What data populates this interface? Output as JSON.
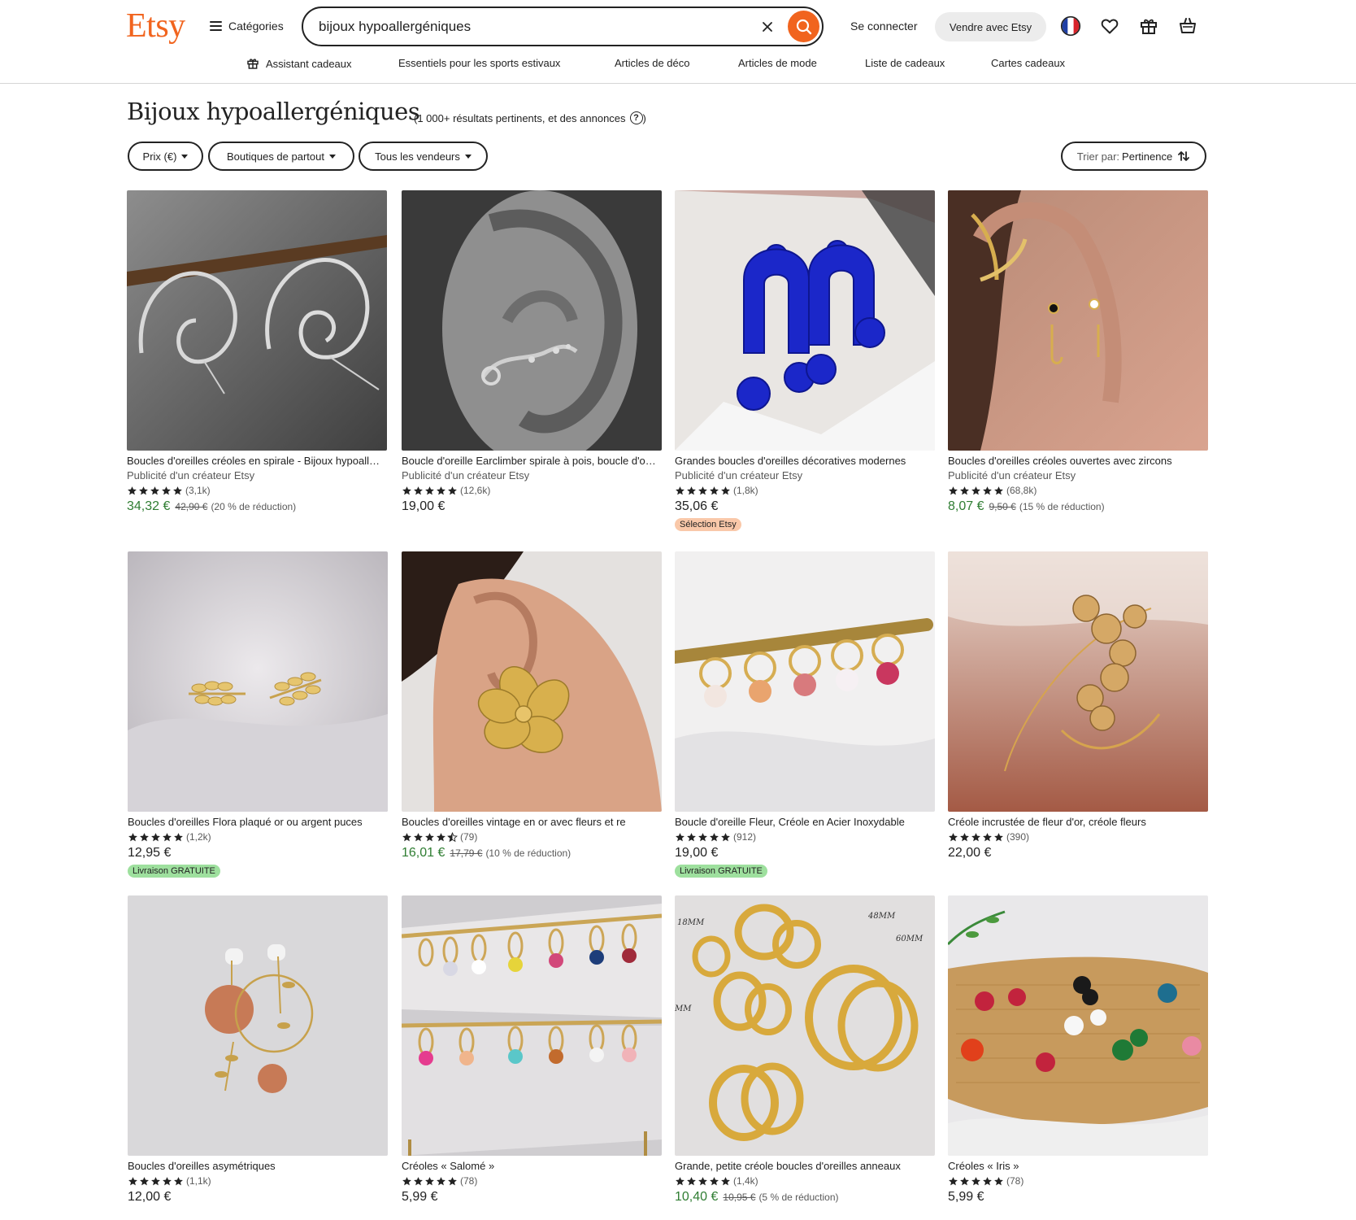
{
  "header": {
    "logo": "Etsy",
    "categories_label": "Catégories",
    "search_value": "bijoux hypoallergéniques",
    "signin_label": "Se connecter",
    "sell_label": "Vendre avec Etsy",
    "icons": [
      "france-flag-icon",
      "heart-icon",
      "gift-icon",
      "cart-icon"
    ]
  },
  "subnav": [
    {
      "label": "Assistant cadeaux",
      "icon": "gift-icon"
    },
    {
      "label": "Essentiels pour les sports estivaux"
    },
    {
      "label": "Articles de déco"
    },
    {
      "label": "Articles de mode"
    },
    {
      "label": "Liste de cadeaux"
    },
    {
      "label": "Cartes cadeaux"
    }
  ],
  "page": {
    "title": "Bijoux hypoallergéniques",
    "results": "(1 000+ résultats pertinents, et des annonces",
    "results_close": ")",
    "help": "?"
  },
  "filters": {
    "price": "Prix (€)",
    "shops": "Boutiques de partout",
    "sellers": "Tous les vendeurs",
    "sort_prefix": "Trier par:",
    "sort_value": "Pertinence"
  },
  "colors": {
    "brand": "#f1641e",
    "sale_price": "#2f7d32",
    "etsy_pick_badge": "#f9c8a9",
    "free_shipping_badge": "#9ee09e"
  },
  "listings": [
    {
      "title": "Boucles d'oreilles créoles en spirale - Bijoux hypoallergéniques",
      "ad": "Publicité d'un créateur Etsy",
      "stars": 5,
      "reviews": "(3,1k)",
      "price": "34,32 €",
      "sale": true,
      "original": "42,90 €",
      "discount": "(20 % de réduction)",
      "badge": ""
    },
    {
      "title": "Boucle d'oreille Earclimber spirale à pois, boucle d'oreille",
      "ad": "Publicité d'un créateur Etsy",
      "stars": 5,
      "reviews": "(12,6k)",
      "price": "19,00 €",
      "sale": false,
      "original": "",
      "discount": "",
      "badge": ""
    },
    {
      "title": "Grandes boucles d'oreilles décoratives modernes",
      "ad": "Publicité d'un créateur Etsy",
      "stars": 5,
      "reviews": "(1,8k)",
      "price": "35,06 €",
      "sale": false,
      "original": "",
      "discount": "",
      "badge": "Sélection Etsy",
      "badge_type": "pick"
    },
    {
      "title": "Boucles d'oreilles créoles ouvertes avec zircons",
      "ad": "Publicité d'un créateur Etsy",
      "stars": 5,
      "reviews": "(68,8k)",
      "price": "8,07 €",
      "sale": true,
      "original": "9,50 €",
      "discount": "(15 % de réduction)",
      "badge": ""
    },
    {
      "title": "Boucles d'oreilles Flora plaqué or ou argent puces",
      "ad": "",
      "stars": 5,
      "reviews": "(1,2k)",
      "price": "12,95 €",
      "sale": false,
      "original": "",
      "discount": "",
      "badge": "Livraison GRATUITE",
      "badge_type": "free"
    },
    {
      "title": "Boucles d'oreilles vintage en or avec fleurs et re",
      "ad": "",
      "stars": 4.5,
      "reviews": "(79)",
      "price": "16,01 €",
      "sale": true,
      "original": "17,79 €",
      "discount": "(10 % de réduction)",
      "badge": ""
    },
    {
      "title": "Boucle d'oreille Fleur, Créole en Acier Inoxydable",
      "ad": "",
      "stars": 5,
      "reviews": "(912)",
      "price": "19,00 €",
      "sale": false,
      "original": "",
      "discount": "",
      "badge": "Livraison GRATUITE",
      "badge_type": "free"
    },
    {
      "title": "Créole incrustée de fleur d'or, créole fleurs",
      "ad": "",
      "stars": 5,
      "reviews": "(390)",
      "price": "22,00 €",
      "sale": false,
      "original": "",
      "discount": "",
      "badge": ""
    },
    {
      "title": "Boucles d'oreilles asymétriques",
      "ad": "",
      "stars": 5,
      "reviews": "(1,1k)",
      "price": "12,00 €",
      "sale": false,
      "original": "",
      "discount": "",
      "badge": ""
    },
    {
      "title": "Créoles « Salomé »",
      "ad": "",
      "stars": 5,
      "reviews": "(78)",
      "price": "5,99 €",
      "sale": false,
      "original": "",
      "discount": "",
      "badge": ""
    },
    {
      "title": "Grande, petite créole boucles d'oreilles anneaux",
      "ad": "",
      "stars": 5,
      "reviews": "(1,4k)",
      "price": "10,40 €",
      "sale": true,
      "original": "10,95 €",
      "discount": "(5 % de réduction)",
      "badge": ""
    },
    {
      "title": "Créoles « Iris »",
      "ad": "",
      "stars": 5,
      "reviews": "(78)",
      "price": "5,99 €",
      "sale": false,
      "original": "",
      "discount": "",
      "badge": ""
    }
  ],
  "photo_labels": {
    "hoops_sizes": [
      "18MM",
      "48MM",
      "60MM",
      "MM"
    ]
  }
}
